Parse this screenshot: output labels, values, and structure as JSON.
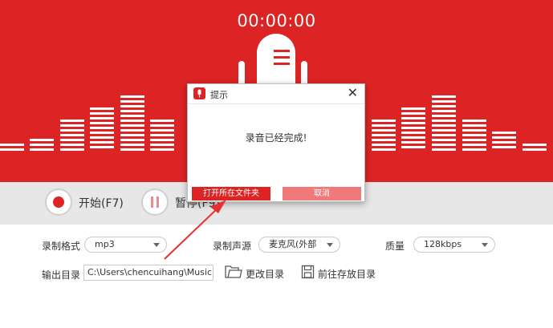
{
  "app": {
    "timer": "00:00:00",
    "accent_color": "#dc2424"
  },
  "controls": {
    "start_label": "开始(F7)",
    "pause_label": "暂停(F9)"
  },
  "settings": {
    "format_label": "录制格式",
    "format_value": "mp3",
    "source_label": "录制声源",
    "source_value": "麦克风(外部",
    "quality_label": "质量",
    "quality_value": "128kbps",
    "output_label": "输出目录",
    "output_value": "C:\\Users\\chencuihang\\Music",
    "change_dir_label": "更改目录",
    "open_dir_label": "前往存放目录"
  },
  "dialog": {
    "title": "提示",
    "message": "录音已经完成!",
    "open_folder_label": "打开所在文件夹",
    "cancel_label": "取消"
  },
  "icons": {
    "mic": "microphone-icon",
    "record": "record-icon",
    "pause": "pause-icon",
    "folder": "folder-icon",
    "save": "save-icon",
    "close": "close-icon"
  }
}
